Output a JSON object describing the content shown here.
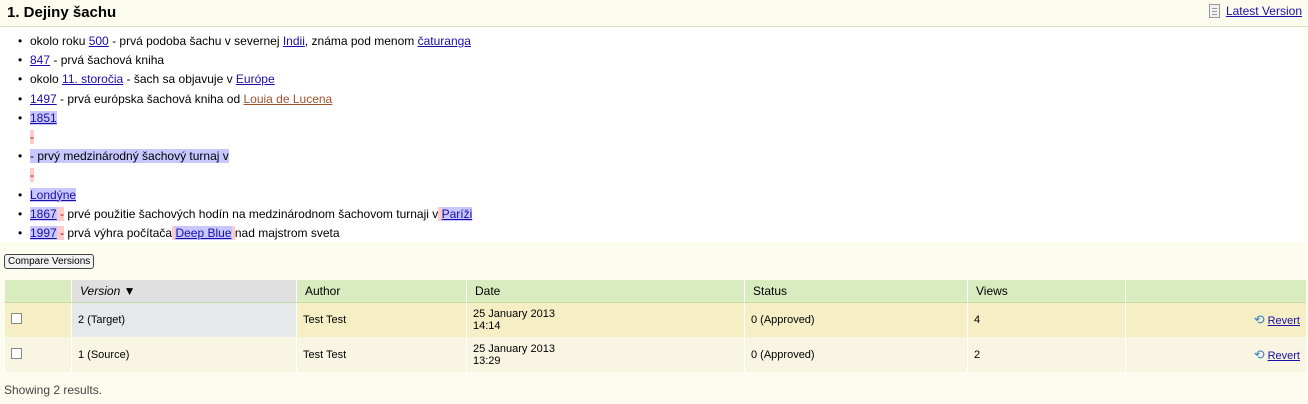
{
  "header": {
    "title": "1. Dejiny šachu",
    "latest_version": "Latest Version"
  },
  "events": [
    {
      "parts": [
        {
          "t": "okolo roku "
        },
        {
          "t": "500",
          "link": true
        },
        {
          "t": " - prvá podoba šachu v severnej "
        },
        {
          "t": "Indii",
          "link": true
        },
        {
          "t": ", známa pod menom "
        },
        {
          "t": "čaturanga",
          "link": true
        }
      ]
    },
    {
      "parts": [
        {
          "t": "847",
          "link": true
        },
        {
          "t": " - prvá šachová kniha"
        }
      ]
    },
    {
      "parts": [
        {
          "t": "okolo "
        },
        {
          "t": "11. storočia",
          "link": true
        },
        {
          "t": " - šach sa objavuje v "
        },
        {
          "t": "Európe",
          "link": true
        }
      ]
    },
    {
      "parts": [
        {
          "t": "1497",
          "link": true
        },
        {
          "t": " - prvá európska šachová kniha od "
        },
        {
          "t": "Louia de Lucena",
          "redlink": true
        }
      ]
    },
    {
      "parts": [
        {
          "t": "1851",
          "link": true,
          "hl": true
        }
      ]
    },
    {
      "parts": [
        {
          "t": "-",
          "hlred": true
        }
      ],
      "nobullet": true
    },
    {
      "parts": [
        {
          "t": "- prvý medzinárodný šachový turnaj v",
          "hl": true
        }
      ]
    },
    {
      "parts": [
        {
          "t": "-",
          "hlred": true
        }
      ],
      "nobullet": true
    },
    {
      "parts": [
        {
          "t": "Londýne",
          "link": true,
          "hl": true
        }
      ]
    },
    {
      "parts": [
        {
          "t": "1867",
          "link": true,
          "hl": true
        },
        {
          "t": " -",
          "hlred": true
        },
        {
          "t": " prvé použitie šachových hodín na medzinárodnom šachovom turnaji v"
        },
        {
          "t": " ",
          "hlred": true
        },
        {
          "t": "Paríži",
          "link": true,
          "hl": true
        }
      ]
    },
    {
      "parts": [
        {
          "t": "1997",
          "link": true,
          "hl": true
        },
        {
          "t": " -",
          "hlred": true
        },
        {
          "t": " prvá výhra počítača"
        },
        {
          "t": " ",
          "hlred": true
        },
        {
          "t": "Deep Blue",
          "link": true,
          "hl": true
        },
        {
          "t": " ",
          "hlred": true
        },
        {
          "t": "nad majstrom sveta"
        }
      ]
    }
  ],
  "compare_button": "Compare Versions",
  "table": {
    "headers": [
      "",
      "Version ▼",
      "Author",
      "Date",
      "Status",
      "Views",
      ""
    ],
    "rows": [
      {
        "version": "2 (Target)",
        "author": "Test Test",
        "date1": "25 January 2013",
        "date2": "14:14",
        "status": "0 (Approved)",
        "views": "4",
        "action": "Revert"
      },
      {
        "version": "1 (Source)",
        "author": "Test Test",
        "date1": "25 January 2013",
        "date2": "13:29",
        "status": "0 (Approved)",
        "views": "2",
        "action": "Revert"
      }
    ]
  },
  "footer": "Showing 2 results.",
  "colors": {
    "link": "#1a0dab",
    "highlight_add": "#c8c8ff",
    "highlight_del": "#ffcccc",
    "header_row": "#d9ecbf"
  },
  "icons": [
    "document-icon",
    "revert-icon",
    "sort-down-icon",
    "checkbox-icon"
  ]
}
